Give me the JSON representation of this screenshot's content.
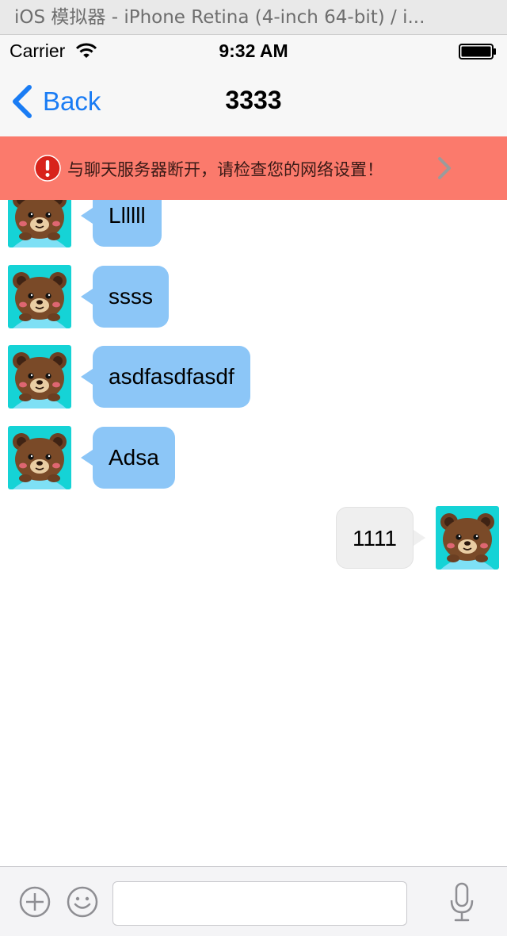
{
  "window": {
    "title": "iOS 模拟器 - iPhone Retina (4-inch 64-bit) / i..."
  },
  "status_bar": {
    "carrier": "Carrier",
    "time": "9:32 AM"
  },
  "nav": {
    "back_label": "Back",
    "title": "3333"
  },
  "alert": {
    "text": "与聊天服务器断开，请检查您的网络设置！"
  },
  "messages": [
    {
      "direction": "incoming",
      "text": "Llllll"
    },
    {
      "direction": "incoming",
      "text": "ssss"
    },
    {
      "direction": "incoming",
      "text": "asdfasdfasdf"
    },
    {
      "direction": "incoming",
      "text": "Adsa"
    },
    {
      "direction": "outgoing",
      "text": "1111"
    }
  ],
  "input_bar": {
    "message_value": "",
    "message_placeholder": ""
  },
  "colors": {
    "accent": "#1a7cf4",
    "alert_background": "#fb7a6c",
    "incoming_bubble": "#8cc6f7",
    "outgoing_bubble": "#efefef",
    "avatar_background": "#15d3d6"
  },
  "icons": [
    "wifi-icon",
    "battery-icon",
    "back-chevron-icon",
    "alert-exclamation-icon",
    "chevron-right-icon",
    "bear-avatar-icon",
    "add-icon",
    "emoji-icon",
    "microphone-icon"
  ]
}
